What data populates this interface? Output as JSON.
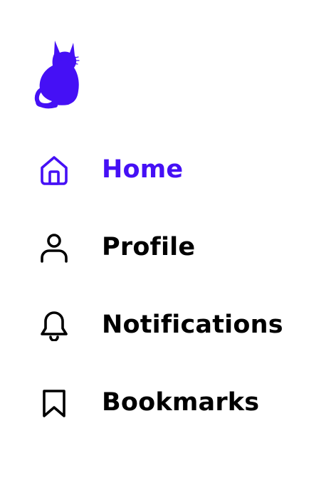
{
  "brand": {
    "logo_icon": "cat-silhouette-icon",
    "color": "#4510f5"
  },
  "nav": {
    "active_color": "#4510f5",
    "default_color": "#000000",
    "items": [
      {
        "label": "Home",
        "icon": "home-icon",
        "active": true
      },
      {
        "label": "Profile",
        "icon": "user-icon",
        "active": false
      },
      {
        "label": "Notifications",
        "icon": "bell-icon",
        "active": false
      },
      {
        "label": "Bookmarks",
        "icon": "bookmark-icon",
        "active": false
      }
    ]
  }
}
